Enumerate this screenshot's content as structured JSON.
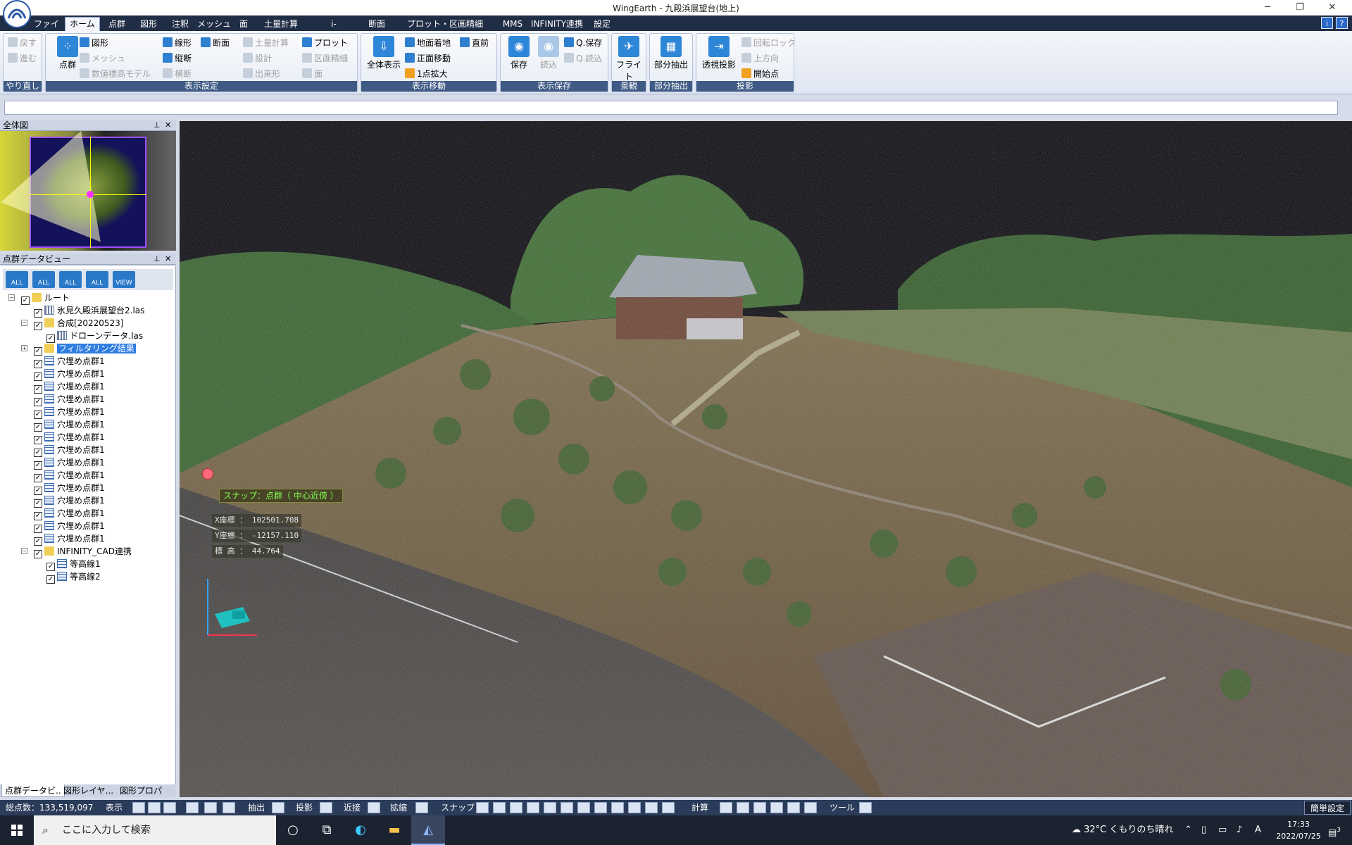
{
  "window": {
    "title": "WingEarth - 九殿浜展望台(地上)",
    "minimize": "─",
    "restore": "❐",
    "close": "✕"
  },
  "menu": {
    "tabs": [
      "ファイル",
      "ホーム",
      "点群",
      "図形",
      "注釈",
      "メッシュ",
      "面",
      "土量計算",
      "i-Construction",
      "断面",
      "プロット・区画精細",
      "MMS",
      "INFINITY連携",
      "設定"
    ],
    "active": "ホーム"
  },
  "ribbon": {
    "undo": {
      "back": "戻す",
      "forward": "進む",
      "label": "やり直し"
    },
    "display": {
      "pointcloud": "点群",
      "figure": "図形",
      "mesh": "メッシュ",
      "dem": "数値標高モデル",
      "line": "線形",
      "section": "断面",
      "longitudinal": "縦断",
      "cross": "横断",
      "earthwork": "土量計算",
      "design": "設計",
      "finished": "出来形",
      "plot": "プロット",
      "parcel": "区画精細",
      "surface": "面",
      "label": "表示設定"
    },
    "move": {
      "all": "全体表示",
      "ground": "地面着地",
      "front": "正面移動",
      "zoom1": "1点拡大",
      "prev": "直前",
      "label": "表示移動"
    },
    "save": {
      "save": "保存",
      "load": "読込",
      "qsave": "Q.保存",
      "qload": "Q.読込",
      "label": "表示保存"
    },
    "view": {
      "flight": "フライト",
      "label": "景観"
    },
    "extract": {
      "partial": "部分抽出",
      "label": "部分抽出"
    },
    "projection": {
      "perspective": "透視投影",
      "rotlock": "回転ロック",
      "up": "上方向",
      "start": "開始点",
      "label": "投影"
    }
  },
  "panels": {
    "overview_title": "全体図",
    "tree_title": "点群データビュー",
    "toolbar": [
      "ALL",
      "ALL",
      "ALL",
      "ALL",
      "VIEW"
    ],
    "tree": [
      {
        "label": "ルート",
        "level": 0,
        "icon": "folder",
        "expander": "−"
      },
      {
        "label": "氷見久殿浜展望台2.las",
        "level": 1,
        "icon": "points",
        "expander": ""
      },
      {
        "label": "合成[20220523]",
        "level": 1,
        "icon": "folder",
        "expander": "−"
      },
      {
        "label": "ドローンデータ.las",
        "level": 2,
        "icon": "points",
        "expander": ""
      },
      {
        "label": "フィルタリング結果",
        "level": 1,
        "icon": "folder",
        "expander": "+",
        "selected": true
      },
      {
        "label": "穴埋め点群1",
        "level": 1,
        "icon": "grid",
        "expander": ""
      },
      {
        "label": "穴埋め点群1",
        "level": 1,
        "icon": "grid",
        "expander": ""
      },
      {
        "label": "穴埋め点群1",
        "level": 1,
        "icon": "grid",
        "expander": ""
      },
      {
        "label": "穴埋め点群1",
        "level": 1,
        "icon": "grid",
        "expander": ""
      },
      {
        "label": "穴埋め点群1",
        "level": 1,
        "icon": "grid",
        "expander": ""
      },
      {
        "label": "穴埋め点群1",
        "level": 1,
        "icon": "grid",
        "expander": ""
      },
      {
        "label": "穴埋め点群1",
        "level": 1,
        "icon": "grid",
        "expander": ""
      },
      {
        "label": "穴埋め点群1",
        "level": 1,
        "icon": "grid",
        "expander": ""
      },
      {
        "label": "穴埋め点群1",
        "level": 1,
        "icon": "grid",
        "expander": ""
      },
      {
        "label": "穴埋め点群1",
        "level": 1,
        "icon": "grid",
        "expander": ""
      },
      {
        "label": "穴埋め点群1",
        "level": 1,
        "icon": "grid",
        "expander": ""
      },
      {
        "label": "穴埋め点群1",
        "level": 1,
        "icon": "grid",
        "expander": ""
      },
      {
        "label": "穴埋め点群1",
        "level": 1,
        "icon": "grid",
        "expander": ""
      },
      {
        "label": "穴埋め点群1",
        "level": 1,
        "icon": "grid",
        "expander": ""
      },
      {
        "label": "穴埋め点群1",
        "level": 1,
        "icon": "grid",
        "expander": ""
      },
      {
        "label": "INFINITY_CAD連携",
        "level": 1,
        "icon": "folder",
        "expander": "−"
      },
      {
        "label": "等高線1",
        "level": 2,
        "icon": "grid",
        "expander": ""
      },
      {
        "label": "等高線2",
        "level": 2,
        "icon": "grid",
        "expander": ""
      }
    ],
    "tabs": [
      "点群データビ..",
      "図形レイヤ...",
      "図形プロパテ..."
    ]
  },
  "viewport": {
    "snap": "スナップ：点群（ 中心近傍 ）",
    "x_label": "X座標 ：",
    "x_value": "102501.708",
    "y_label": "Y座標 ：",
    "y_value": "-12157.110",
    "z_label": "標 高 ：",
    "z_value": "44.764"
  },
  "statusbar": {
    "total": "総点数：133,519,097",
    "display": "表示",
    "extract": "抽出",
    "projection": "投影",
    "near": "近接",
    "enlarge": "拡縮",
    "snap": "スナップ",
    "calc": "計算",
    "tool": "ツール",
    "easy": "簡単設定"
  },
  "taskbar": {
    "search_placeholder": "ここに入力して検索",
    "weather": "32°C くもりのち晴れ",
    "ime": "A",
    "time": "17:33",
    "date": "2022/07/25",
    "notif_count": "3"
  },
  "colors": {
    "menubar": "#1f2d45",
    "group_label": "#3f5a84",
    "accent": "#2e86d8",
    "selection": "#2f7de1"
  }
}
